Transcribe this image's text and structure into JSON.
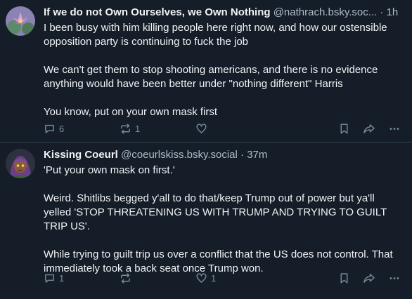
{
  "posts": [
    {
      "author_name": "If we do not Own Ourselves, we Own Nothing",
      "handle": "@nathrach.bsky.soc...",
      "separator": "·",
      "time": "1h",
      "paragraphs": [
        "I been busy with him killing people here right now, and how our ostensible opposition party is continuing to fuck the job",
        "We can't get them to stop shooting americans, and there is no evidence anything would have been better under \"nothing different\" Harris",
        "You know, put on your own mask first"
      ],
      "reply_count": "6",
      "repost_count": "1",
      "like_count": ""
    },
    {
      "author_name": "Kissing Coeurl",
      "handle": "@coeurlskiss.bsky.social",
      "separator": "·",
      "time": "37m",
      "paragraphs": [
        "'Put your own mask on first.'",
        "Weird. Shitlibs begged y'all to do that/keep Trump out of power but ya'll yelled 'STOP THREATENING US WITH TRUMP AND TRYING TO GUILT TRIP US'.",
        "While trying to guilt trip us over a conflict that the US does not control. That immediately took a back seat once Trump won."
      ],
      "reply_count": "1",
      "repost_count": "",
      "like_count": "1"
    }
  ],
  "icons": {
    "reply": "reply-icon",
    "repost": "repost-icon",
    "like": "heart-icon",
    "bookmark": "bookmark-icon",
    "share": "share-icon",
    "more": "more-icon"
  },
  "colors": {
    "background": "#151d28",
    "divider": "#2e4052",
    "text": "#f1f3f5",
    "muted": "#aebbc9",
    "icon": "#788ba0"
  }
}
